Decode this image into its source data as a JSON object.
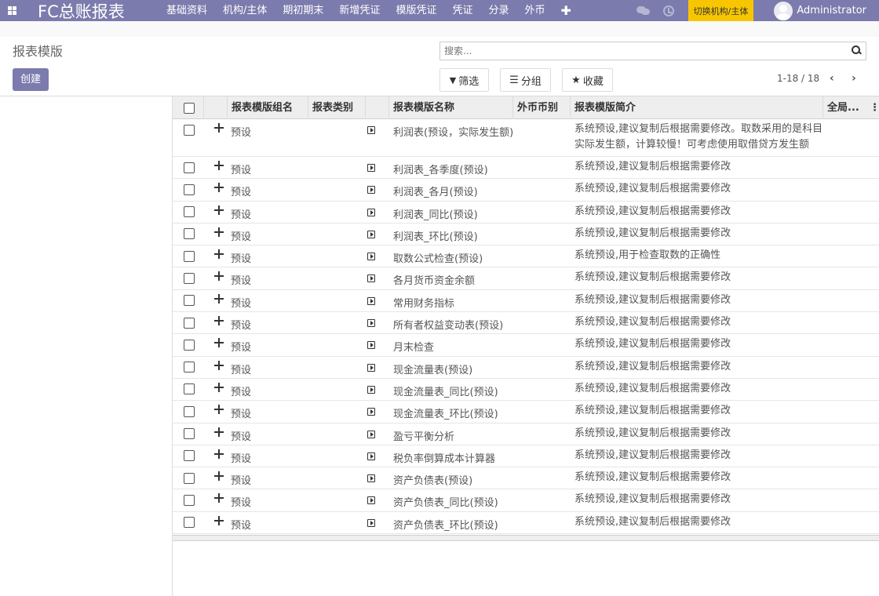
{
  "navbar": {
    "brand": "FC总账报表",
    "menu": [
      "基础资料",
      "机构/主体",
      "期初期末",
      "新增凭证",
      "模版凭证",
      "凭证",
      "分录",
      "外币"
    ],
    "plus": "✚",
    "switch_label": "切换机构/主体",
    "user": "Administrator"
  },
  "control_panel": {
    "title": "报表模版",
    "create_label": "创建",
    "search_placeholder": "搜索...",
    "filter_label": "筛选",
    "group_label": "分组",
    "favorite_label": "收藏",
    "pager": "1-18 / 18"
  },
  "table": {
    "columns": [
      "报表模版组名",
      "报表类别",
      "报表模版名称",
      "外币币别",
      "报表模版简介",
      "全局..."
    ],
    "rows": [
      {
        "group": "预设",
        "name": "利润表(预设，实际发生额)",
        "intro": "系统预设,建议复制后根据需要修改。取数采用的是科目实际发生额，计算较慢！可考虑使用取借贷方发生额"
      },
      {
        "group": "预设",
        "name": "利润表_各季度(预设)",
        "intro": "系统预设,建议复制后根据需要修改"
      },
      {
        "group": "预设",
        "name": "利润表_各月(预设)",
        "intro": "系统预设,建议复制后根据需要修改"
      },
      {
        "group": "预设",
        "name": "利润表_同比(预设)",
        "intro": "系统预设,建议复制后根据需要修改"
      },
      {
        "group": "预设",
        "name": "利润表_环比(预设)",
        "intro": "系统预设,建议复制后根据需要修改"
      },
      {
        "group": "预设",
        "name": "取数公式检查(预设)",
        "intro": "系统预设,用于检查取数的正确性"
      },
      {
        "group": "预设",
        "name": "各月货币资金余额",
        "intro": "系统预设,建议复制后根据需要修改"
      },
      {
        "group": "预设",
        "name": "常用财务指标",
        "intro": "系统预设,建议复制后根据需要修改"
      },
      {
        "group": "预设",
        "name": "所有者权益变动表(预设)",
        "intro": "系统预设,建议复制后根据需要修改"
      },
      {
        "group": "预设",
        "name": "月末检查",
        "intro": "系统预设,建议复制后根据需要修改"
      },
      {
        "group": "预设",
        "name": "现金流量表(预设)",
        "intro": "系统预设,建议复制后根据需要修改"
      },
      {
        "group": "预设",
        "name": "现金流量表_同比(预设)",
        "intro": "系统预设,建议复制后根据需要修改"
      },
      {
        "group": "预设",
        "name": "现金流量表_环比(预设)",
        "intro": "系统预设,建议复制后根据需要修改"
      },
      {
        "group": "预设",
        "name": "盈亏平衡分析",
        "intro": "系统预设,建议复制后根据需要修改"
      },
      {
        "group": "预设",
        "name": "税负率倒算成本计算器",
        "intro": "系统预设,建议复制后根据需要修改"
      },
      {
        "group": "预设",
        "name": "资产负债表(预设)",
        "intro": "系统预设,建议复制后根据需要修改"
      },
      {
        "group": "预设",
        "name": "资产负债表_同比(预设)",
        "intro": "系统预设,建议复制后根据需要修改"
      },
      {
        "group": "预设",
        "name": "资产负债表_环比(预设)",
        "intro": "系统预设,建议复制后根据需要修改"
      }
    ]
  },
  "icons": {
    "apps": "apps-grid-icon",
    "chat": "chat-icon",
    "activity": "clock-icon",
    "search": "search-icon",
    "filter": "filter-icon",
    "group": "list-icon",
    "favorite": "star-icon",
    "drag": "move-icon",
    "open": "open-record-icon"
  },
  "colors": {
    "navbar": "#7c7bad",
    "switch_button": "#f7c600",
    "create_button": "#7c7bad"
  }
}
